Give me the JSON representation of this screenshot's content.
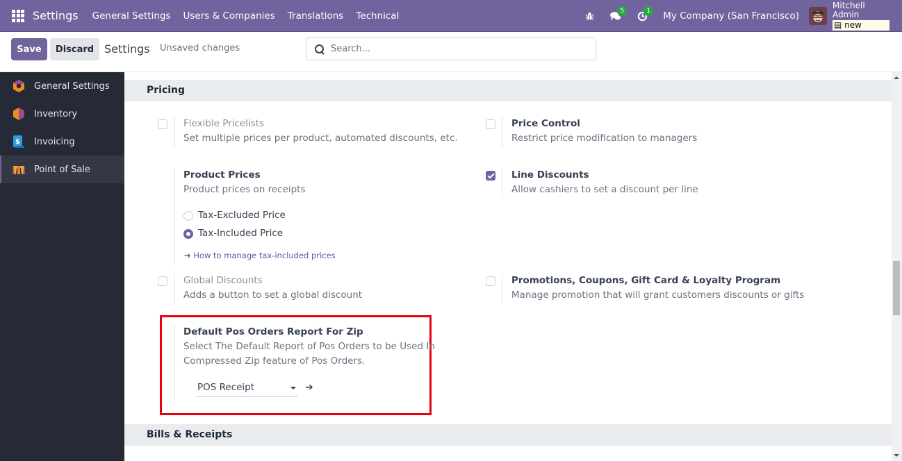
{
  "navbar": {
    "app_title": "Settings",
    "menu": [
      "General Settings",
      "Users & Companies",
      "Translations",
      "Technical"
    ],
    "icons": {
      "apps": "apps-grid-icon",
      "debug": "bug-icon",
      "messages": "chat-icon",
      "activities": "clock-icon"
    },
    "messages_count": "5",
    "activities_count": "1",
    "company": "My Company (San Francisco)",
    "user_name": "Mitchell Admin",
    "database": "new"
  },
  "control_panel": {
    "save_label": "Save",
    "discard_label": "Discard",
    "title": "Settings",
    "status": "Unsaved changes",
    "search_placeholder": "Search..."
  },
  "sidebar": {
    "items": [
      {
        "label": "General Settings",
        "icon": "general-settings-icon",
        "active": false
      },
      {
        "label": "Inventory",
        "icon": "inventory-icon",
        "active": false
      },
      {
        "label": "Invoicing",
        "icon": "invoicing-icon",
        "active": false
      },
      {
        "label": "Point of Sale",
        "icon": "point-of-sale-icon",
        "active": true
      }
    ]
  },
  "sections": {
    "pricing": {
      "title": "Pricing",
      "settings": {
        "flexible_pricelists": {
          "title": "Flexible Pricelists",
          "desc": "Set multiple prices per product, automated discounts, etc.",
          "checked": false,
          "disabled": true
        },
        "price_control": {
          "title": "Price Control",
          "desc": "Restrict price modification to managers",
          "checked": false
        },
        "product_prices": {
          "title": "Product Prices",
          "desc": "Product prices on receipts",
          "options": [
            "Tax-Excluded Price",
            "Tax-Included Price"
          ],
          "selected": "Tax-Included Price",
          "link": "➔ How to manage tax-included prices"
        },
        "line_discounts": {
          "title": "Line Discounts",
          "desc": "Allow cashiers to set a discount per line",
          "checked": true
        },
        "global_discounts": {
          "title": "Global Discounts",
          "desc": "Adds a button to set a global discount",
          "checked": false,
          "disabled": true
        },
        "promotions": {
          "title": "Promotions, Coupons, Gift Card & Loyalty Program",
          "desc": "Manage promotion that will grant customers discounts or gifts",
          "checked": false
        },
        "default_zip_report": {
          "title": "Default Pos Orders Report For Zip",
          "desc_line1": "Select The Default Report of Pos Orders to be Used In",
          "desc_line2": "Compressed Zip feature of Pos Orders.",
          "value": "POS Receipt",
          "highlight_color": "#e8000b"
        }
      }
    },
    "bills": {
      "title": "Bills & Receipts"
    }
  },
  "colors": {
    "brand": "#71639e",
    "sidebar_bg": "#262a36",
    "section_bg": "#e9ecef"
  }
}
